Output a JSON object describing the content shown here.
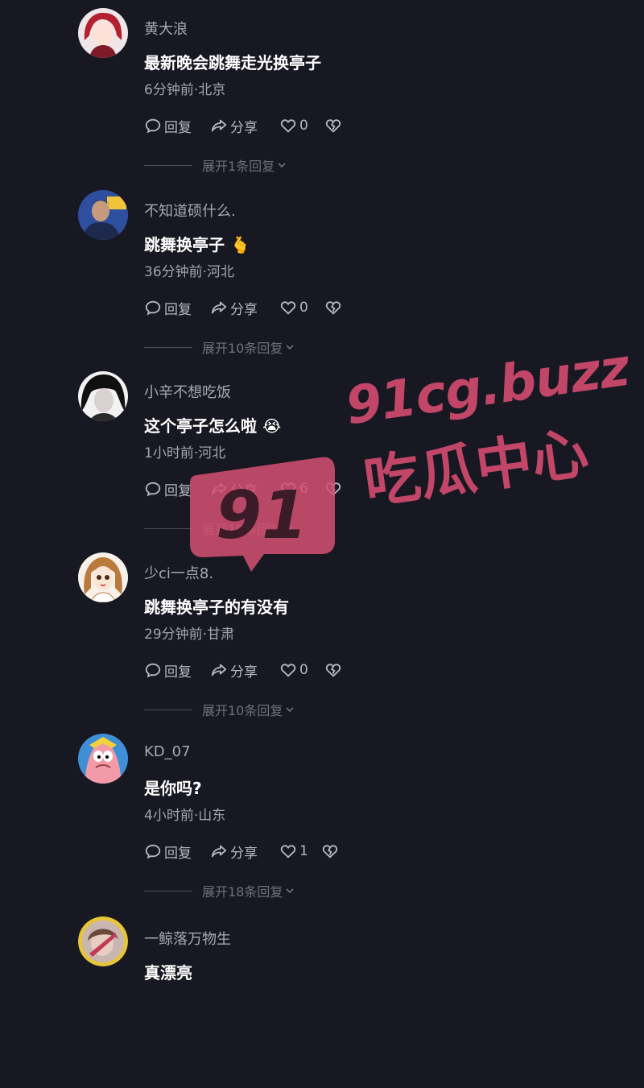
{
  "labels": {
    "reply": "回复",
    "share": "分享"
  },
  "colors": {
    "background": "#171822",
    "watermark": "#e65078"
  },
  "comments": [
    {
      "username": "黄大浪",
      "text": "最新晚会跳舞走光换亭子",
      "meta": "6分钟前·北京",
      "likes": "0",
      "expand": "展开1条回复",
      "avatar": "avatar-girl-red-hair"
    },
    {
      "username": "不知道硕什么.",
      "text": "跳舞换亭子 🫰",
      "meta": "36分钟前·河北",
      "likes": "0",
      "expand": "展开10条回复",
      "avatar": "avatar-man-blue"
    },
    {
      "username": "小辛不想吃饭",
      "text": "这个亭子怎么啦 😭",
      "meta": "1小时前·河北",
      "likes": "6",
      "expand": "展开19条回复",
      "avatar": "avatar-dark-portrait"
    },
    {
      "username": "少ci一点8.",
      "text": "跳舞换亭子的有没有",
      "meta": "29分钟前·甘肃",
      "likes": "0",
      "expand": "展开10条回复",
      "avatar": "avatar-cartoon-girl"
    },
    {
      "username": "KD_07",
      "text": "是你吗?",
      "meta": "4小时前·山东",
      "likes": "1",
      "expand": "展开18条回复",
      "avatar": "avatar-patrick-cartoon"
    },
    {
      "username": "一鲸落万物生",
      "text": "真漂亮",
      "meta": "",
      "likes": "",
      "expand": "",
      "avatar": "avatar-yellow-ring"
    }
  ],
  "watermark": {
    "number": "91",
    "url": "91cg.buzz",
    "name": "吃瓜中心"
  }
}
